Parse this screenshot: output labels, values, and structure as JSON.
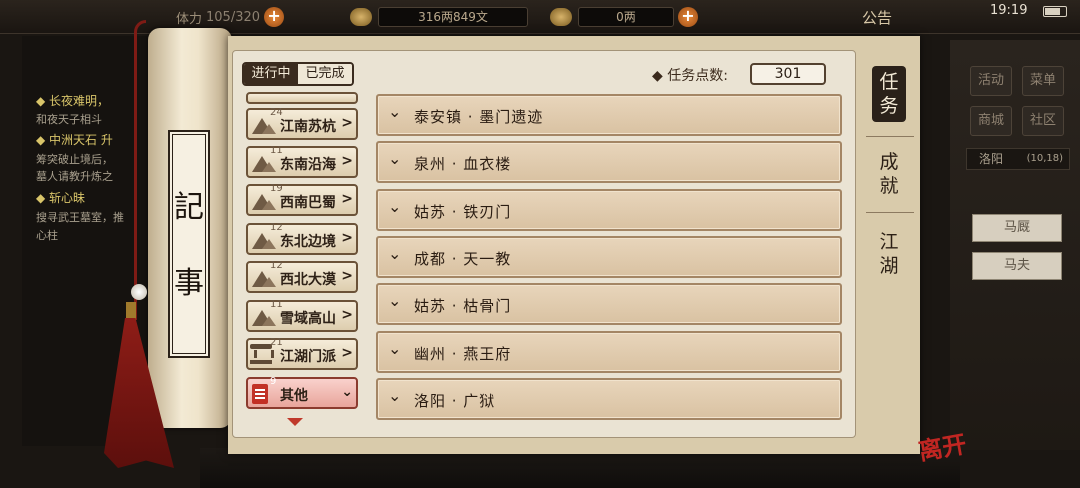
{
  "hud": {
    "stamina_label": "体力",
    "stamina": "105/320",
    "money": "316两849文",
    "gold": "0两",
    "notice": "公告",
    "time": "19:19"
  },
  "background_quests": [
    {
      "title": "◆ 长夜难明，",
      "desc": "和夜天子相斗"
    },
    {
      "title": "◆ 中洲天石 升",
      "desc": "筹突破止境后，"
    },
    {
      "title": "",
      "desc": "墓人请教升炼之"
    },
    {
      "title": "◆ 斩心昧",
      "desc": "搜寻武王墓室，推"
    },
    {
      "title": "",
      "desc": "心柱"
    }
  ],
  "right_panel": {
    "buttons": [
      "活动",
      "菜单",
      "商城",
      "社区"
    ],
    "location": "洛阳",
    "coords": "(10,18)",
    "npcs": [
      "马厩",
      "马夫"
    ]
  },
  "scroll": {
    "title_chars": [
      "記",
      "事"
    ]
  },
  "filter": {
    "in_progress": "进行中",
    "completed": "已完成"
  },
  "task_points": {
    "label": "◆ 任务点数:",
    "value": "301"
  },
  "regions": [
    {
      "num": "24",
      "name": "江南苏杭",
      "icon": "mountain-icon",
      "arrow": ">"
    },
    {
      "num": "11",
      "name": "东南沿海",
      "icon": "mountain-icon",
      "arrow": ">"
    },
    {
      "num": "19",
      "name": "西南巴蜀",
      "icon": "mountain-icon",
      "arrow": ">"
    },
    {
      "num": "12",
      "name": "东北边境",
      "icon": "mountain-icon",
      "arrow": ">"
    },
    {
      "num": "12",
      "name": "西北大漠",
      "icon": "mountain-icon",
      "arrow": ">"
    },
    {
      "num": "11",
      "name": "雪域高山",
      "icon": "mountain-icon",
      "arrow": ">"
    },
    {
      "num": "21",
      "name": "江湖门派",
      "icon": "temple-icon",
      "arrow": ">"
    },
    {
      "num": "9",
      "name": "其他",
      "icon": "document-icon",
      "arrow": "⌄",
      "active": true
    }
  ],
  "quests": [
    {
      "name": "泰安镇 · 墨门遗迹"
    },
    {
      "name": "泉州 · 血衣楼"
    },
    {
      "name": "姑苏 · 铁刃门"
    },
    {
      "name": "成都 · 天一教"
    },
    {
      "name": "姑苏 · 枯骨门"
    },
    {
      "name": "幽州 · 燕王府"
    },
    {
      "name": "洛阳 · 广狱"
    }
  ],
  "side_tabs": [
    {
      "label": "任\n务",
      "chars": [
        "任",
        "务"
      ],
      "selected": true
    },
    {
      "label": "成就",
      "chars": [
        "成",
        "就"
      ],
      "selected": false
    },
    {
      "label": "江湖",
      "chars": [
        "江",
        "湖"
      ],
      "selected": false
    }
  ],
  "logo": "离开",
  "colors": {
    "active_region": "#e8a59b",
    "selected_tab": "#2a2119",
    "paper": "#d9cbab"
  }
}
